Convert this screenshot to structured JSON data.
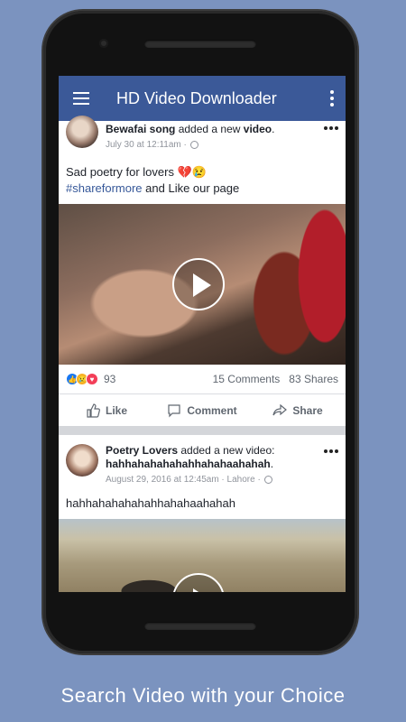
{
  "app": {
    "title": "HD Video Downloader"
  },
  "posts": [
    {
      "author": "Bewafai song",
      "action_text": " added a new ",
      "action_strong": "video",
      "action_tail": ".",
      "timestamp": "July 30 at 12:11am · ",
      "text_line1": "Sad poetry for lovers 💔😢",
      "hashtag": "#shareformore",
      "text_line2_tail": " and Like our page",
      "reaction_count": "93",
      "comments": "15 Comments",
      "shares": "83 Shares"
    },
    {
      "author": "Poetry Lovers",
      "action_text": " added a new video:",
      "bold_title": "hahhahahahahahhahahaahahah",
      "action_tail": ".",
      "timestamp": "August 29, 2016 at 12:45am · Lahore · ",
      "text": "hahhahahahahahhahahaahahah"
    }
  ],
  "actions": {
    "like": "Like",
    "comment": "Comment",
    "share": "Share"
  },
  "footer": {
    "caption": "Search Video with your Choice"
  },
  "colors": {
    "background": "#7b93bf",
    "appbar": "#3b5998",
    "link": "#365899"
  },
  "icons": [
    "menu-icon",
    "more-vert-icon",
    "globe-icon",
    "play-icon",
    "like-icon",
    "comment-icon",
    "share-icon"
  ]
}
